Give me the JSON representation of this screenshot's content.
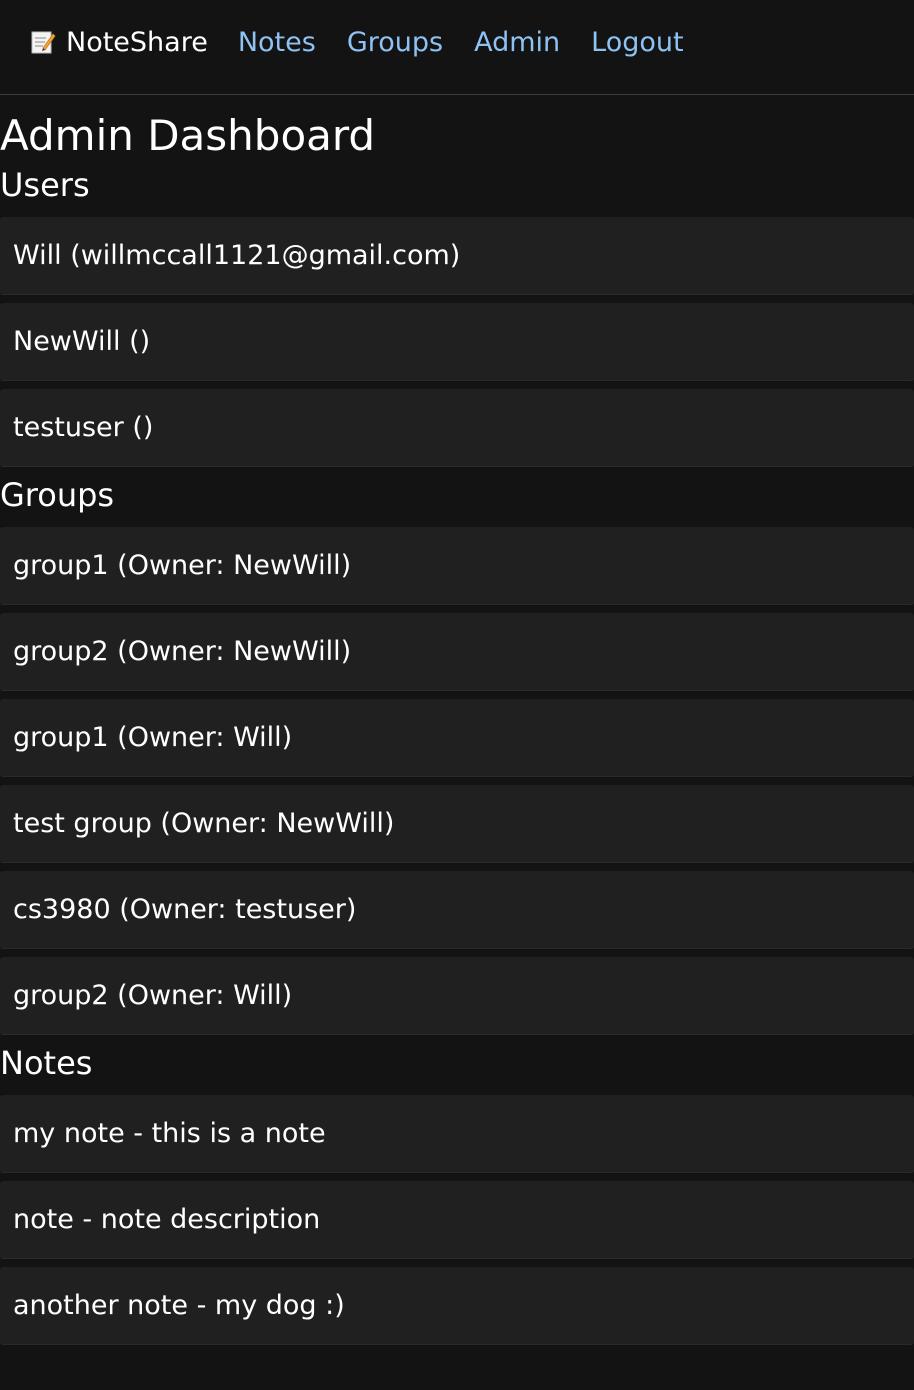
{
  "nav": {
    "brand": "NoteShare",
    "brand_icon": "memo-icon",
    "links": [
      "Notes",
      "Groups",
      "Admin",
      "Logout"
    ]
  },
  "page": {
    "title": "Admin Dashboard"
  },
  "users": {
    "title": "Users",
    "items": [
      "Will (willmccall1121@gmail.com)",
      "NewWill ()",
      "testuser ()"
    ]
  },
  "groups": {
    "title": "Groups",
    "items": [
      "group1 (Owner: NewWill)",
      "group2 (Owner: NewWill)",
      "group1 (Owner: Will)",
      "test group (Owner: NewWill)",
      "cs3980 (Owner: testuser)",
      "group2 (Owner: Will)"
    ]
  },
  "notes": {
    "title": "Notes",
    "items": [
      "my note - this is a note",
      "note - note description",
      "another note - my dog :)"
    ]
  },
  "colors": {
    "background": "#131313",
    "card": "#202020",
    "link": "#8ec2f2",
    "text": "#ffffff"
  }
}
